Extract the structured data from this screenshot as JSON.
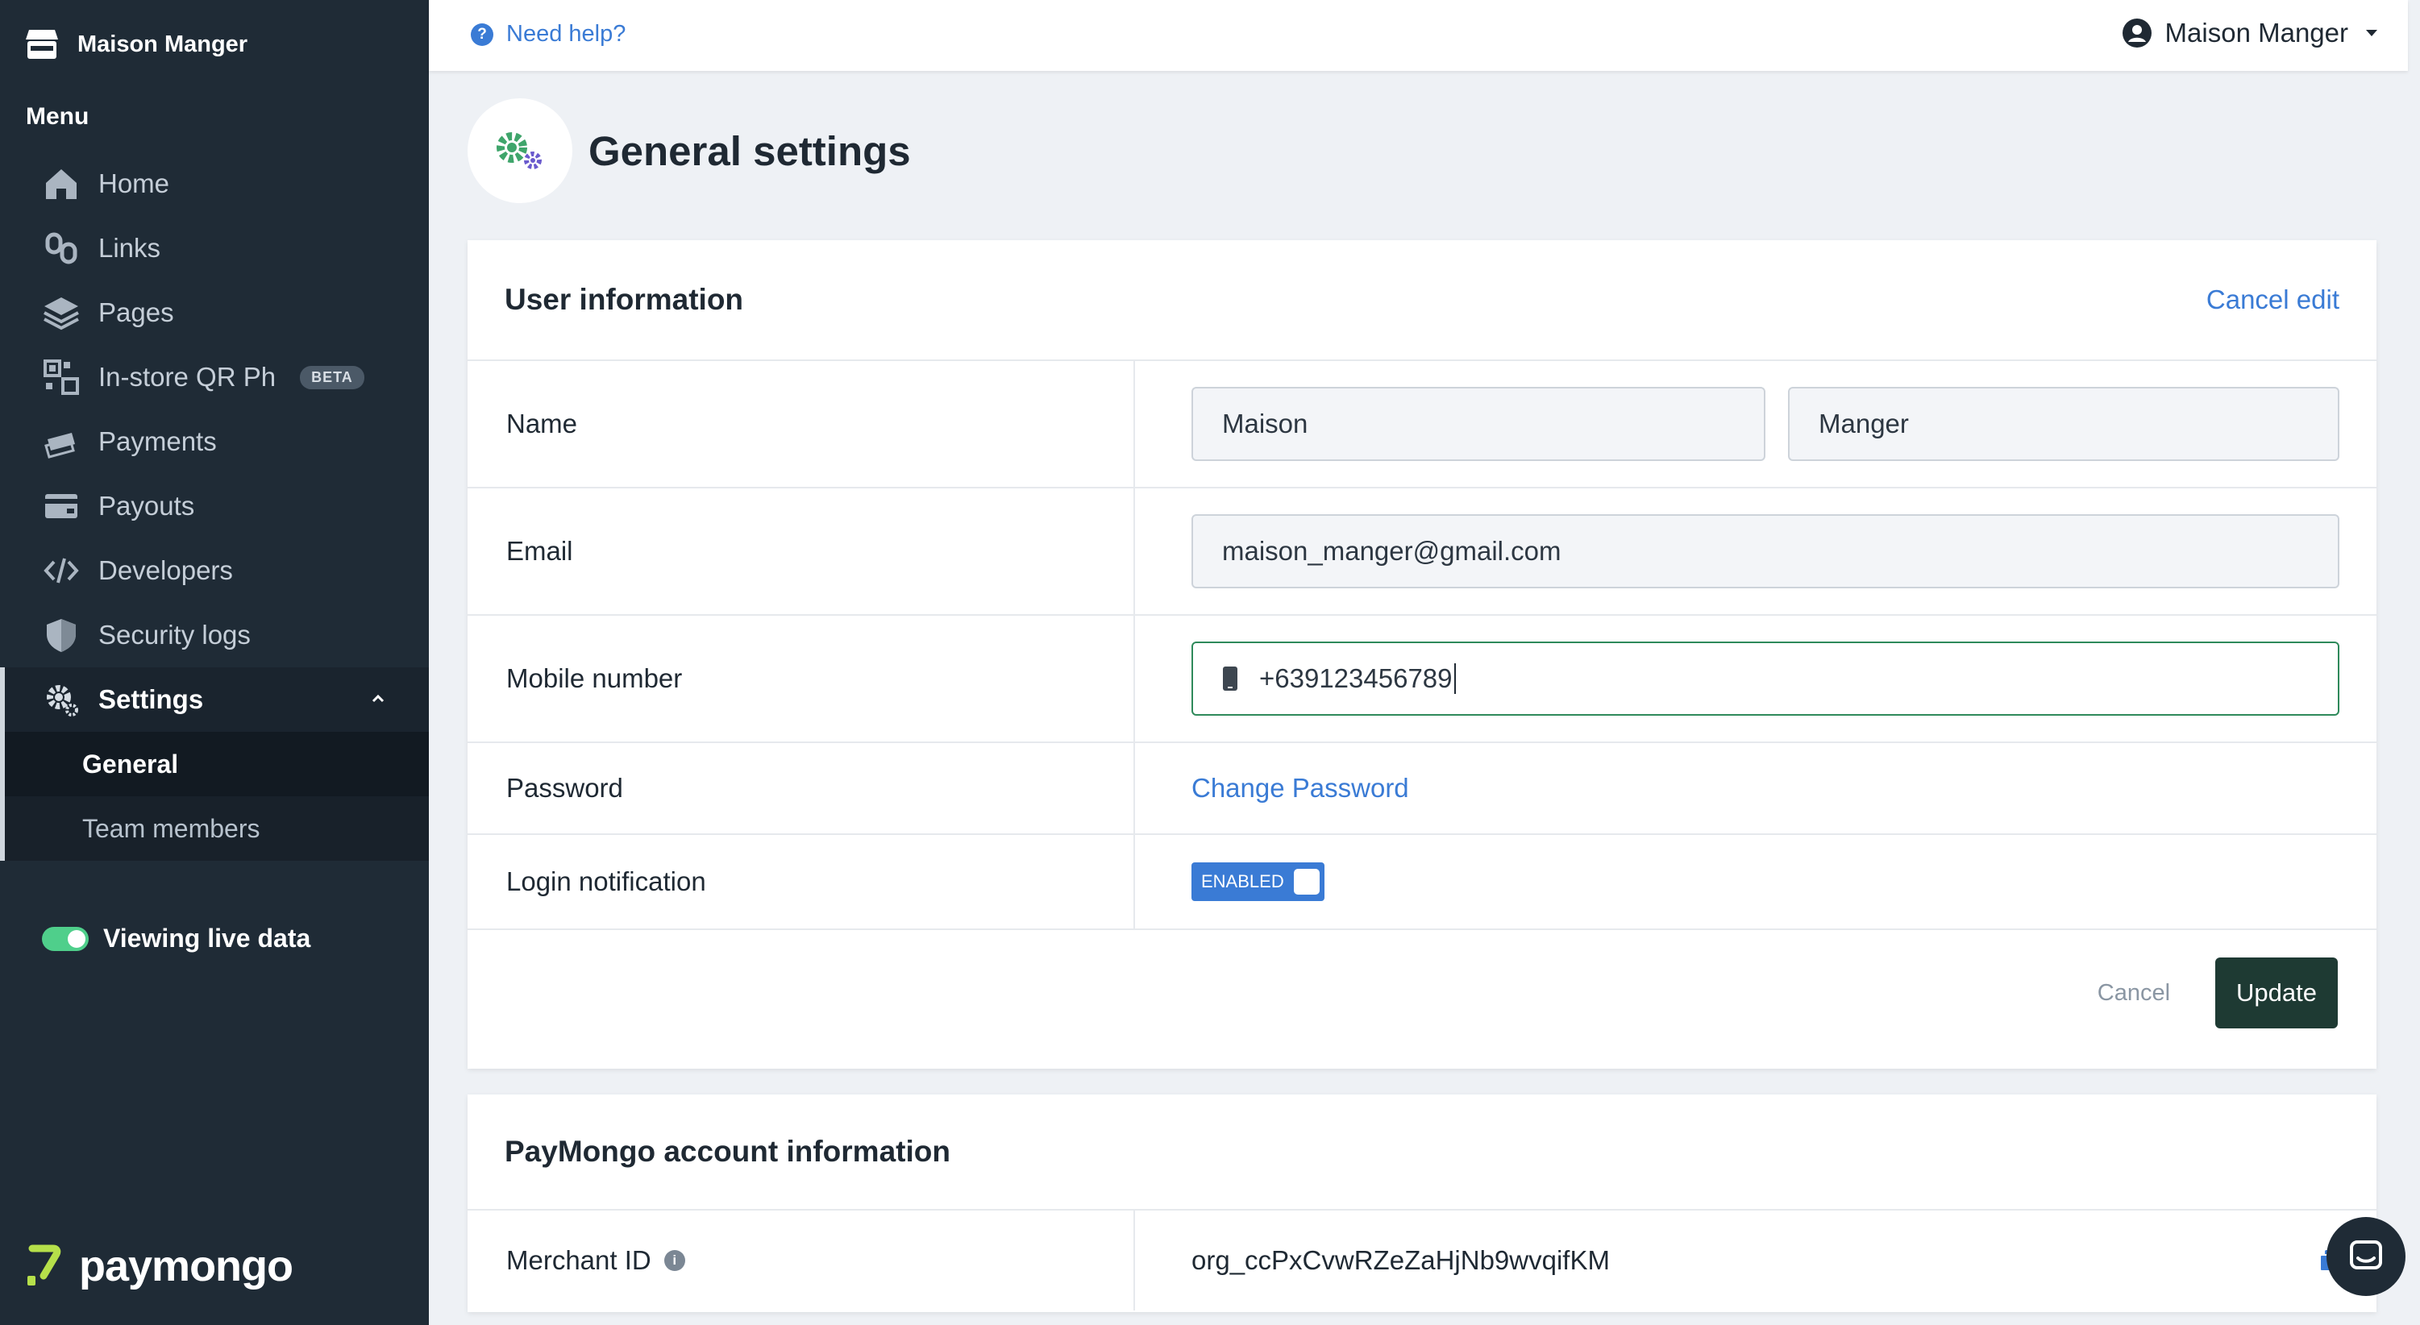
{
  "sidebar": {
    "brand_name": "Maison Manger",
    "menu_label": "Menu",
    "items": [
      {
        "label": "Home",
        "icon": "home-icon"
      },
      {
        "label": "Links",
        "icon": "links-icon"
      },
      {
        "label": "Pages",
        "icon": "pages-icon"
      },
      {
        "label": "In-store QR Ph",
        "icon": "qr-icon",
        "badge": "BETA"
      },
      {
        "label": "Payments",
        "icon": "payments-icon"
      },
      {
        "label": "Payouts",
        "icon": "payouts-icon"
      },
      {
        "label": "Developers",
        "icon": "code-icon"
      },
      {
        "label": "Security logs",
        "icon": "shield-icon"
      },
      {
        "label": "Settings",
        "icon": "gear-icon"
      }
    ],
    "sub_items": [
      {
        "label": "General"
      },
      {
        "label": "Team members"
      }
    ],
    "live_label": "Viewing live data",
    "logo_text": "paymongo"
  },
  "topbar": {
    "help_label": "Need help?",
    "user_name": "Maison Manger"
  },
  "page": {
    "title": "General settings"
  },
  "user_info": {
    "title": "User information",
    "cancel_edit": "Cancel edit",
    "name_label": "Name",
    "first_name": "Maison",
    "last_name": "Manger",
    "email_label": "Email",
    "email": "maison_manger@gmail.com",
    "mobile_label": "Mobile number",
    "mobile": "+639123456789",
    "password_label": "Password",
    "change_password": "Change Password",
    "login_notification_label": "Login notification",
    "login_notification_state": "ENABLED",
    "cancel": "Cancel",
    "update": "Update"
  },
  "account_info": {
    "title": "PayMongo account information",
    "merchant_id_label": "Merchant ID",
    "merchant_id": "org_ccPxCvwRZeZaHjNb9wvqifKM"
  },
  "colors": {
    "sidebar_bg": "#1f2b36",
    "accent_blue": "#3a7bd5",
    "live_green": "#4fcf8b",
    "update_button": "#1e3a33"
  }
}
